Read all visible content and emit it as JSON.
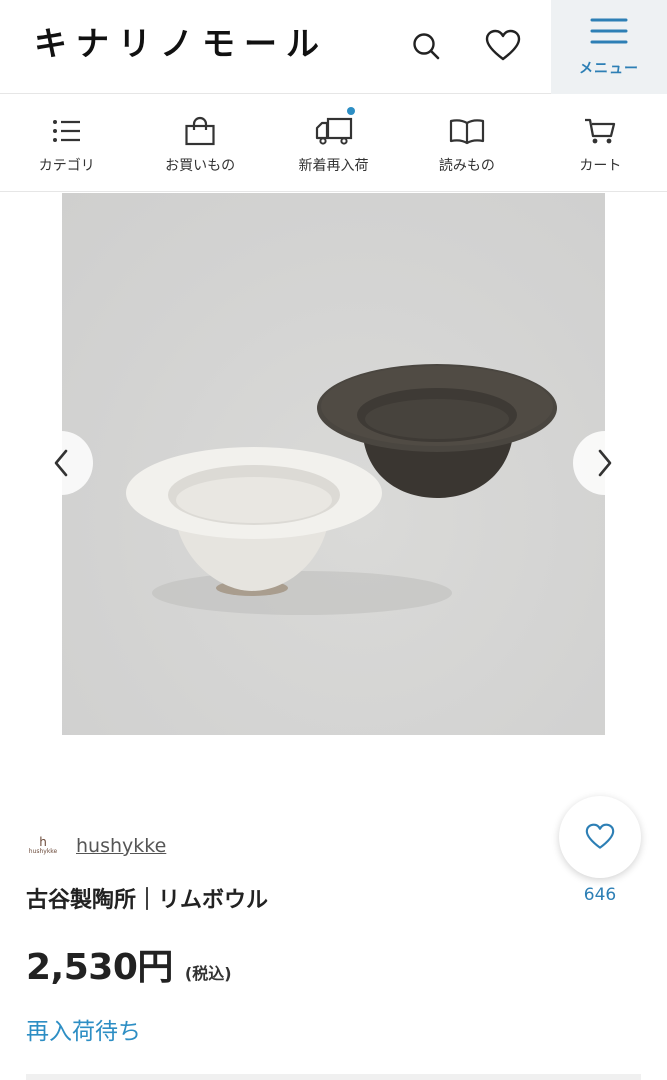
{
  "header": {
    "logo": "キナリノモール",
    "menu_label": "メニュー",
    "icons": {
      "search": "search-icon",
      "favorite": "heart-icon",
      "menu": "hamburger-icon"
    }
  },
  "nav": {
    "items": [
      {
        "label": "カテゴリ",
        "icon": "list-icon"
      },
      {
        "label": "お買いもの",
        "icon": "shopping-bag-icon"
      },
      {
        "label": "新着再入荷",
        "icon": "delivery-truck-icon",
        "has_badge": true
      },
      {
        "label": "読みもの",
        "icon": "open-book-icon"
      },
      {
        "label": "カート",
        "icon": "cart-icon"
      }
    ],
    "badge_color": "#2d8ec4"
  },
  "gallery": {
    "prev_icon": "chevron-left-icon",
    "next_icon": "chevron-right-icon"
  },
  "product": {
    "brand_logo": {
      "mark": "h",
      "text": "hushykke"
    },
    "brand_name": "hushykke",
    "title": "古谷製陶所｜リムボウル",
    "price": "2,530円",
    "tax_note": "(税込)",
    "status": "再入荷待ち",
    "favorite_count": "646"
  },
  "colors": {
    "accent": "#2d8ec4",
    "menu_bg": "#eef1f3",
    "text": "#222222"
  }
}
